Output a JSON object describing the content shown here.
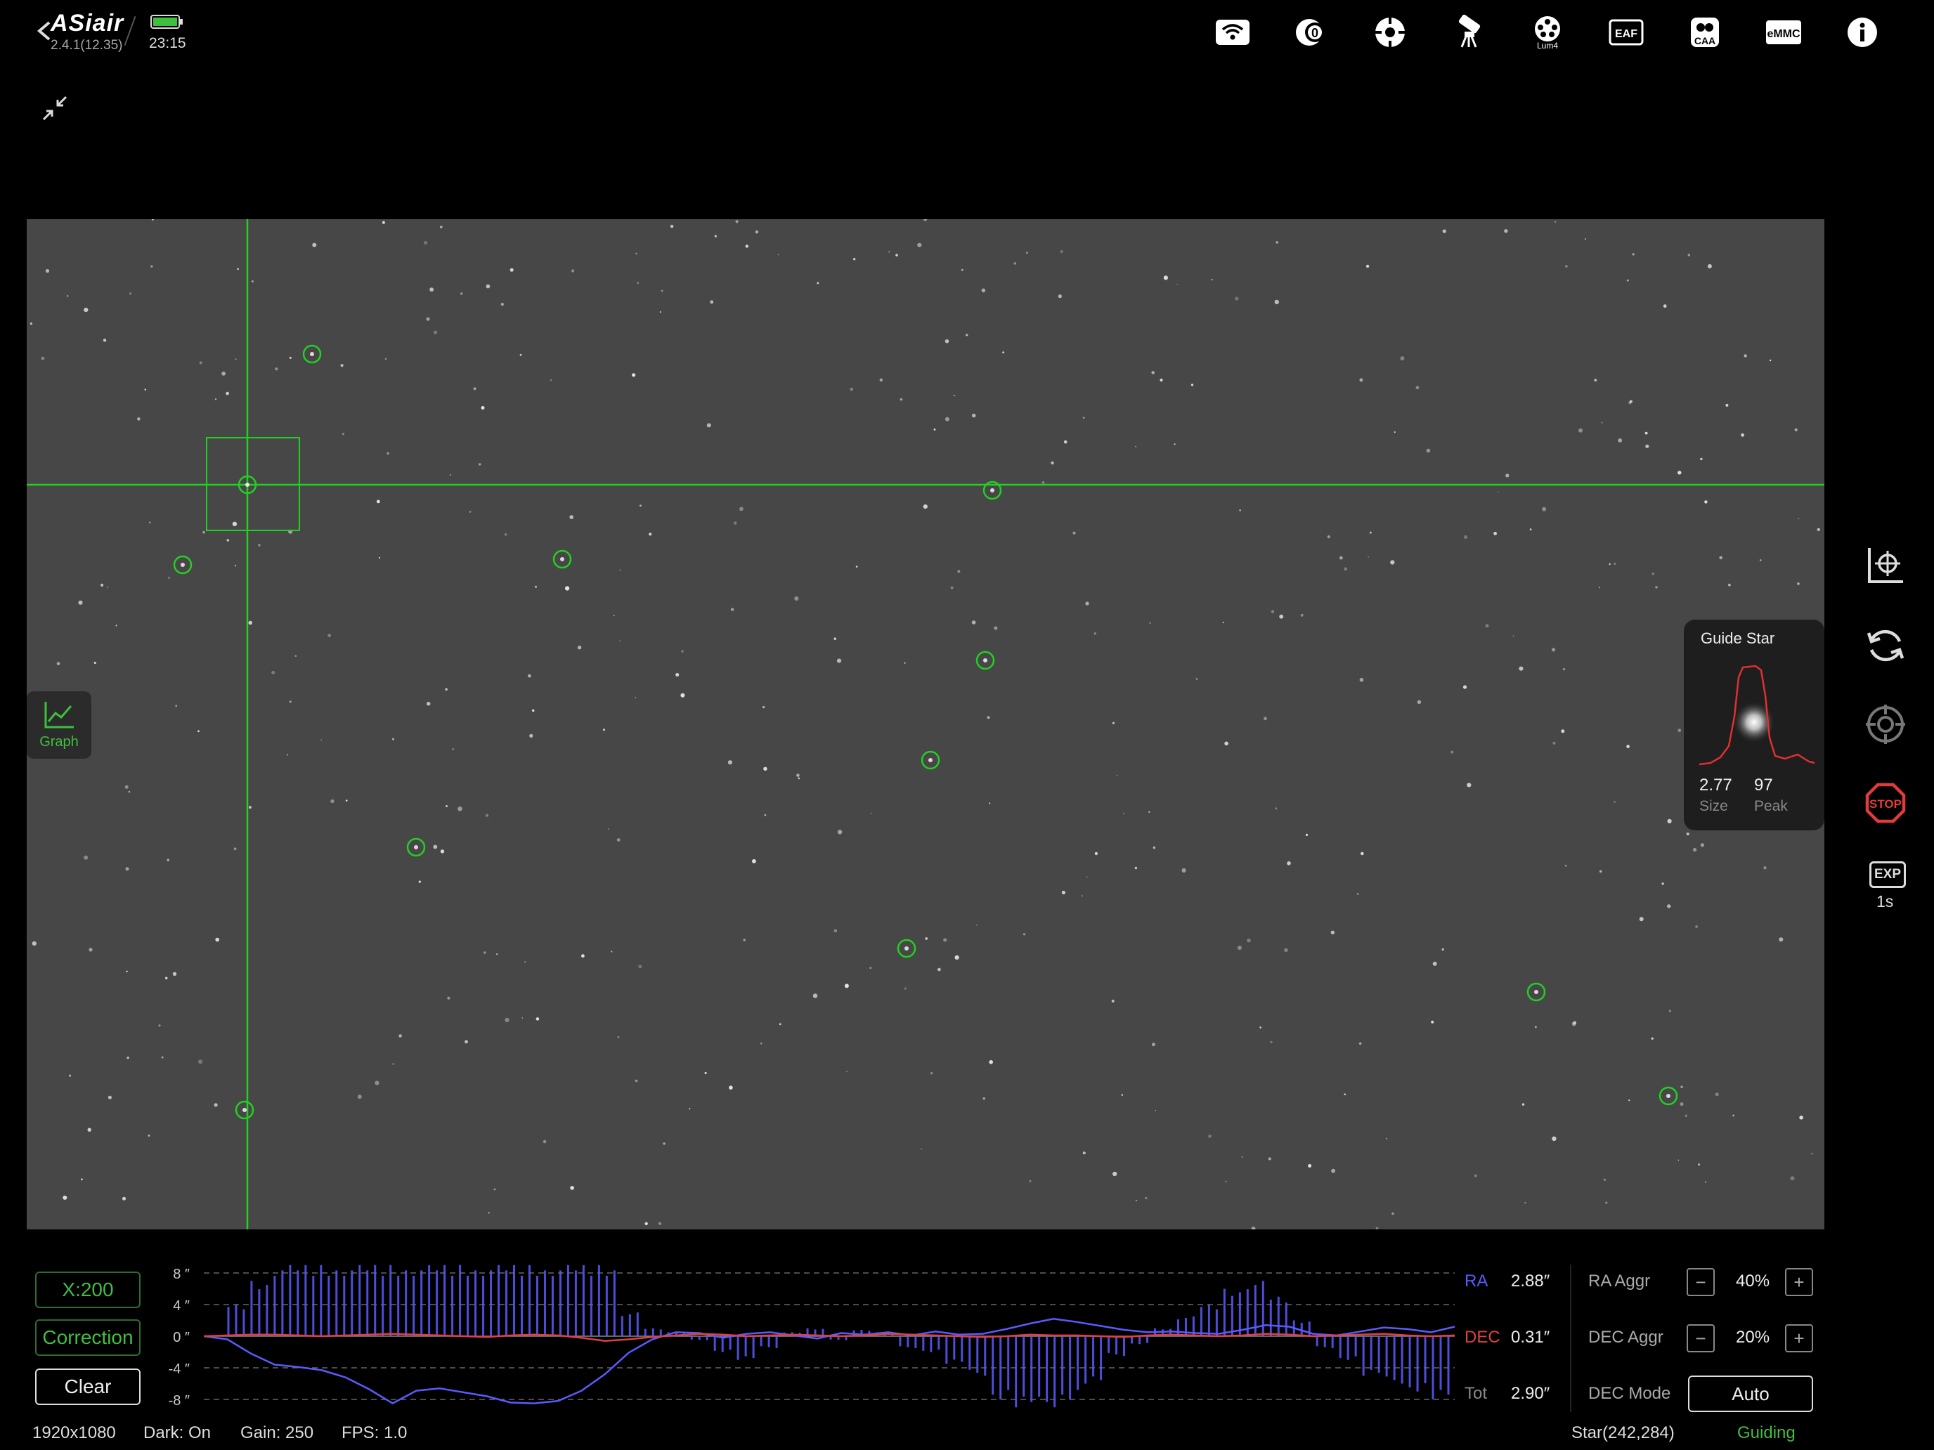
{
  "app": {
    "name": "ASiair",
    "version": "2.4.1(12.35)",
    "time": "23:15"
  },
  "top_icons": [
    {
      "name": "wifi-icon"
    },
    {
      "name": "camera-icon"
    },
    {
      "name": "guide-camera-icon"
    },
    {
      "name": "telescope-mount-icon"
    },
    {
      "name": "filter-wheel-icon",
      "label": "Lum4"
    },
    {
      "name": "eaf-focuser-icon",
      "label": "EAF"
    },
    {
      "name": "caa-rotator-icon",
      "label": "CAA"
    },
    {
      "name": "emmc-storage-icon",
      "label": "eMMC"
    },
    {
      "name": "info-icon"
    }
  ],
  "graph_button": {
    "label": "Graph"
  },
  "guide_star": {
    "title": "Guide Star",
    "size": "2.77",
    "size_label": "Size",
    "peak": "97",
    "peak_label": "Peak"
  },
  "exposure": {
    "badge": "EXP",
    "value": "1s"
  },
  "bottom": {
    "x_scale": "X:200",
    "correction": "Correction",
    "clear": "Clear",
    "ra_label": "RA",
    "ra_value": "2.88″",
    "dec_label": "DEC",
    "dec_value": "0.31″",
    "tot_label": "Tot",
    "tot_value": "2.90″",
    "ra_aggr_label": "RA Aggr",
    "ra_aggr_value": "40%",
    "dec_aggr_label": "DEC Aggr",
    "dec_aggr_value": "20%",
    "dec_mode_label": "DEC Mode",
    "dec_mode_value": "Auto",
    "minus": "−",
    "plus": "+"
  },
  "status_bar": {
    "resolution": "1920x1080",
    "dark": "Dark: On",
    "gain": "Gain: 250",
    "fps": "FPS: 1.0",
    "star": "Star(242,284)",
    "state": "Guiding"
  },
  "colors": {
    "accent": "#3fbf3f",
    "ra": "#5a5aff",
    "dec": "#e04040",
    "stop": "#e23b3b"
  },
  "chart_data": {
    "type": "line",
    "y_ticks": [
      "8 ″",
      "4 ″",
      "0 ″",
      "-4 ″",
      "-8 ″"
    ],
    "ylim": [
      -8,
      8
    ],
    "series": [
      {
        "name": "RA",
        "values": [
          0,
          -0.4,
          -2.2,
          -3.6,
          -3.9,
          -4.3,
          -5.2,
          -6.7,
          -8.5,
          -6.9,
          -6.6,
          -7.1,
          -7.6,
          -8.4,
          -8.9,
          -8.2,
          -6.9,
          -4.8,
          -2.1,
          -0.4,
          0.5,
          0.4,
          -0.2,
          0.3,
          0.5,
          0.1,
          -0.3,
          0.4,
          0.2,
          0.5,
          0.1,
          0.6,
          0.2,
          0.3,
          0.9,
          1.6,
          2.2,
          1.8,
          1.3,
          0.8,
          0.5,
          0.6,
          0.4,
          0.3,
          0.8,
          1.4,
          1.2,
          0.3,
          0.1,
          0.6,
          1.1,
          0.9,
          0.5,
          1.2
        ]
      },
      {
        "name": "DEC",
        "values": [
          0,
          0.1,
          0.2,
          0.2,
          0.1,
          0,
          0.1,
          0.2,
          0.3,
          0.2,
          0.1,
          0,
          -0.1,
          0.1,
          0.2,
          0.1,
          -0.2,
          -0.6,
          -0.4,
          -0.1,
          0.1,
          0.3,
          0.2,
          0,
          0.1,
          0.2,
          0.1,
          0,
          0.1,
          0.3,
          0.2,
          0.1,
          0,
          -0.1,
          0,
          0.2,
          0.1,
          0.1,
          0,
          -0.1,
          0.1,
          0.2,
          0.1,
          0,
          0.1,
          0.3,
          0.2,
          0,
          0.1,
          0.2,
          0.3,
          0.1,
          0,
          0.1
        ]
      }
    ],
    "ra_corrections": [
      0,
      4,
      7,
      9,
      9,
      9,
      9,
      9,
      9,
      9,
      9,
      9,
      9,
      9,
      9,
      9,
      9,
      9,
      3,
      1,
      0.5,
      -0.5,
      -2,
      -3,
      -1.5,
      0.5,
      1,
      -0.5,
      0.8,
      0.5,
      -1.5,
      -2,
      -3.5,
      -5,
      -8,
      -9,
      -9,
      -8,
      -6,
      -2.5,
      -1,
      1,
      2.5,
      4,
      6,
      7,
      5,
      2,
      -1.5,
      -3,
      -5,
      -6,
      -7,
      -8
    ]
  }
}
